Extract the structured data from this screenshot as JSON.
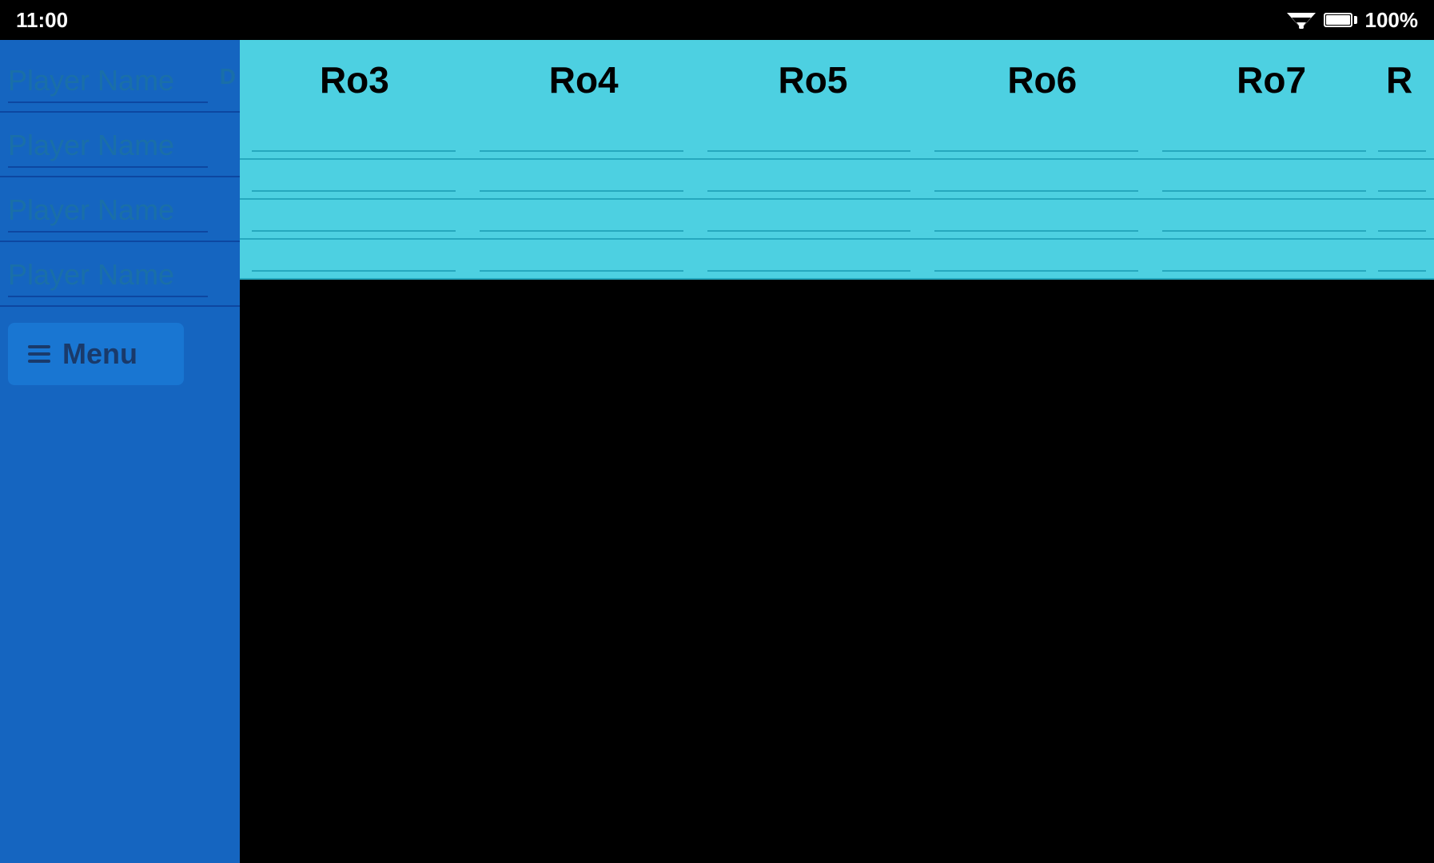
{
  "statusBar": {
    "time": "11:00",
    "batteryPercent": "100%"
  },
  "sidebar": {
    "players": [
      {
        "id": 1,
        "placeholder": "Player Name",
        "showD": true
      },
      {
        "id": 2,
        "placeholder": "Player Name",
        "showD": false
      },
      {
        "id": 3,
        "placeholder": "Player Name",
        "showD": false
      },
      {
        "id": 4,
        "placeholder": "Player Name",
        "showD": false
      }
    ],
    "menuLabel": "Menu"
  },
  "grid": {
    "columns": [
      "Ro3",
      "Ro4",
      "Ro5",
      "Ro6",
      "Ro7",
      "R"
    ],
    "rowCount": 4
  },
  "backButton": {
    "label": "←"
  }
}
